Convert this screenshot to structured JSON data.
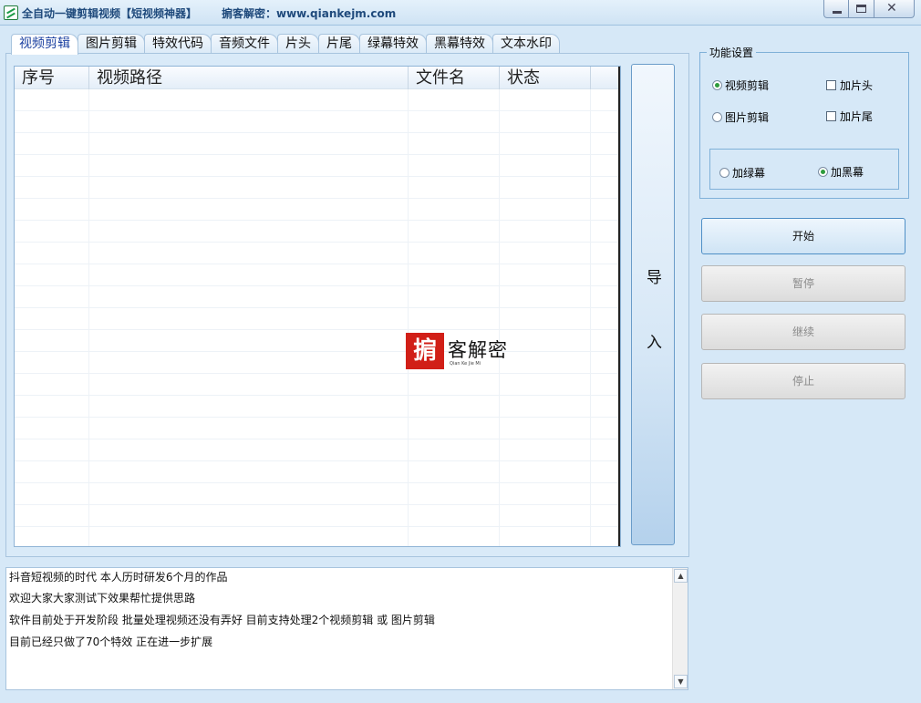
{
  "window": {
    "title": "全自动一键剪辑视频【短视频神器】",
    "site": "掮客解密：www.qiankejm.com"
  },
  "tabs": [
    {
      "label": "视频剪辑",
      "active": true
    },
    {
      "label": "图片剪辑",
      "active": false
    },
    {
      "label": "特效代码",
      "active": false
    },
    {
      "label": "音频文件",
      "active": false
    },
    {
      "label": "片头",
      "active": false
    },
    {
      "label": "片尾",
      "active": false
    },
    {
      "label": "绿幕特效",
      "active": false
    },
    {
      "label": "黑幕特效",
      "active": false
    },
    {
      "label": "文本水印",
      "active": false
    }
  ],
  "grid": {
    "columns": [
      "序号",
      "视频路径",
      "文件名",
      "状态",
      ""
    ],
    "rows": []
  },
  "watermark": {
    "seal": "掮",
    "text": "客解密",
    "sub": "Qian Ke Jie Mi"
  },
  "import_button": {
    "chars": [
      "导",
      "入"
    ]
  },
  "log": {
    "lines": [
      "抖音短视频的时代      本人历时研发6个月的作品",
      "欢迎大家大家测试下效果帮忙提供思路",
      "软件目前处于开发阶段    批量处理视频还没有弄好    目前支持处理2个视频剪辑  或  图片剪辑",
      "目前已经只做了70个特效      正在进一步扩展"
    ]
  },
  "settings": {
    "legend": "功能设置",
    "mode_video": {
      "label": "视频剪辑",
      "selected": true
    },
    "mode_image": {
      "label": "图片剪辑",
      "selected": false
    },
    "add_intro": {
      "label": "加片头",
      "checked": false
    },
    "add_outro": {
      "label": "加片尾",
      "checked": false
    },
    "green_screen": {
      "label": "加绿幕",
      "selected": false
    },
    "black_screen": {
      "label": "加黑幕",
      "selected": true
    }
  },
  "actions": {
    "start": "开始",
    "pause": "暂停",
    "resume": "继续",
    "stop": "停止"
  },
  "colors": {
    "window_bg": "#d6e8f7",
    "title_text": "#1f4a7c",
    "active_tab_text": "#1a3fa0",
    "radio_on": "#2e9b3c",
    "seal_red": "#d11f17"
  }
}
